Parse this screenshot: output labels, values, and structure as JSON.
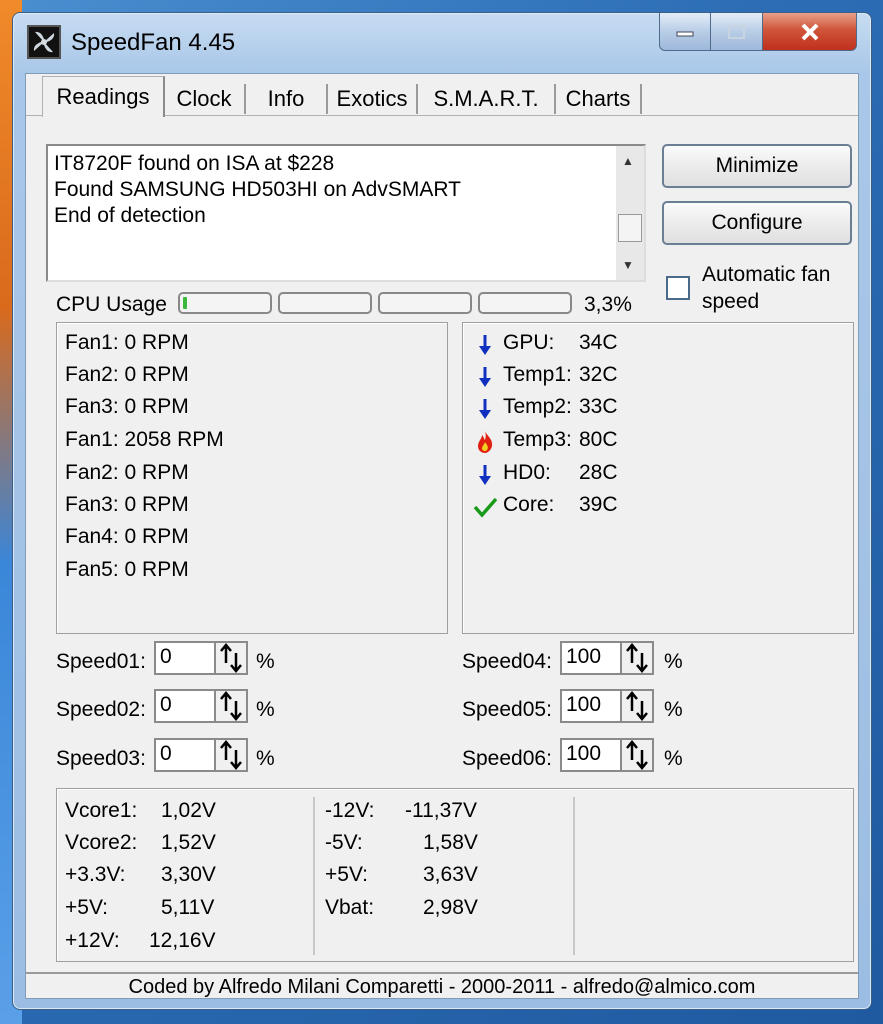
{
  "window": {
    "title": "SpeedFan 4.45"
  },
  "tabs": [
    {
      "label": "Readings"
    },
    {
      "label": "Clock"
    },
    {
      "label": "Info"
    },
    {
      "label": "Exotics"
    },
    {
      "label": "S.M.A.R.T."
    },
    {
      "label": "Charts"
    }
  ],
  "log": {
    "lines": [
      "IT8720F found on ISA at $228",
      "Found SAMSUNG HD503HI on AdvSMART",
      "End of detection"
    ]
  },
  "buttons": {
    "minimize": "Minimize",
    "configure": "Configure"
  },
  "auto_fan": {
    "label_line1": "Automatic fan",
    "label_line2": "speed",
    "checked": false
  },
  "cpu": {
    "label": "CPU Usage",
    "percent_text": "3,3%",
    "usage_fraction": 0.033
  },
  "fans": [
    "Fan1: 0 RPM",
    "Fan2: 0 RPM",
    "Fan3: 0 RPM",
    "Fan1: 2058 RPM",
    "Fan2: 0 RPM",
    "Fan3: 0 RPM",
    "Fan4: 0 RPM",
    "Fan5: 0 RPM"
  ],
  "temps": [
    {
      "name": "GPU:",
      "value": "34C",
      "icon": "arrow-down-icon"
    },
    {
      "name": "Temp1:",
      "value": "32C",
      "icon": "arrow-down-icon"
    },
    {
      "name": "Temp2:",
      "value": "33C",
      "icon": "arrow-down-icon"
    },
    {
      "name": "Temp3:",
      "value": "80C",
      "icon": "flame-icon"
    },
    {
      "name": "HD0:",
      "value": "28C",
      "icon": "arrow-down-icon"
    },
    {
      "name": "Core:",
      "value": "39C",
      "icon": "checkmark-icon"
    }
  ],
  "speeds": [
    {
      "label": "Speed01:",
      "value": "0",
      "unit": "%"
    },
    {
      "label": "Speed02:",
      "value": "0",
      "unit": "%"
    },
    {
      "label": "Speed03:",
      "value": "0",
      "unit": "%"
    },
    {
      "label": "Speed04:",
      "value": "100",
      "unit": "%"
    },
    {
      "label": "Speed05:",
      "value": "100",
      "unit": "%"
    },
    {
      "label": "Speed06:",
      "value": "100",
      "unit": "%"
    }
  ],
  "voltages": {
    "left": [
      {
        "name": "Vcore1:",
        "value": "1,02V"
      },
      {
        "name": "Vcore2:",
        "value": "1,52V"
      },
      {
        "name": "+3.3V:",
        "value": "3,30V"
      },
      {
        "name": "+5V:",
        "value": "5,11V"
      },
      {
        "name": "+12V:",
        "value": "12,16V"
      }
    ],
    "right": [
      {
        "name": "-12V:",
        "value": "-11,37V"
      },
      {
        "name": "-5V:",
        "value": "1,58V"
      },
      {
        "name": "+5V:",
        "value": "3,63V"
      },
      {
        "name": "Vbat:",
        "value": "2,98V"
      }
    ]
  },
  "status": {
    "text": "Coded by Alfredo Milani Comparetti - 2000-2011 - alfredo@almico.com"
  },
  "colors": {
    "arrow_blue": "#1030c0",
    "flame_red": "#e02010",
    "flame_yellow": "#f0d020",
    "check_green": "#1a9a1a",
    "cpu_green": "#3cb83c"
  }
}
